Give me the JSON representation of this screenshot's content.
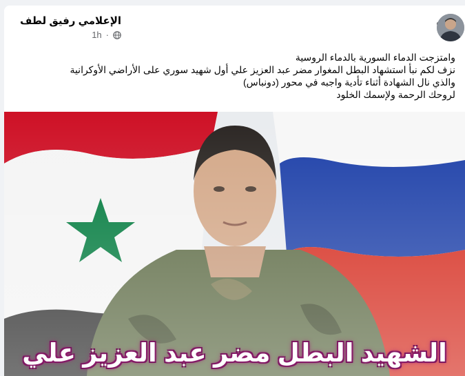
{
  "post": {
    "author_name": "الإعلامي رفيق لطف",
    "timestamp": "1h",
    "text_lines": [
      "وامتزجت الدماء السورية بالدماء الروسية",
      "نزف لكم نبأ استشهاد البطل المغوار مضر عبد العزيز علي أول شهيد سوري على الأراضي الأوكرانية",
      "والذي نال الشهادة أثناء تأدية واجبه في محور (دونباس)",
      "لروحك الرحمة ولإسمك الخلود"
    ],
    "more_icon": "more-horizontal-icon",
    "privacy_icon": "globe-icon",
    "photo": {
      "caption": "الشهيد البطل مضر عبد العزيز علي",
      "flags": [
        "Syria",
        "Russia"
      ],
      "colors": {
        "syria_red": "#ce1126",
        "syria_green": "#007a3d",
        "russia_blue": "#1c3fa8",
        "russia_red": "#d52b1e",
        "caption_glow": "#b0287f"
      }
    }
  }
}
